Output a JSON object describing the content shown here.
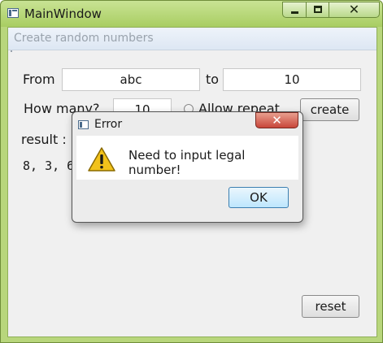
{
  "window": {
    "title": "MainWindow",
    "icon": "app-window-icon",
    "minimize_icon": "minimize-icon",
    "maximize_icon": "maximize-icon",
    "close_icon": "close-icon",
    "close_glyph": "✕"
  },
  "toolbar": {
    "label": "Create random numbers"
  },
  "form": {
    "from_label": "From",
    "from_value": "abc",
    "to_label": "to",
    "to_value": "10",
    "how_many_label": "How many?",
    "how_many_value": "10",
    "allow_repeat_label": "Allow repeat",
    "create_label": "create",
    "result_label": "result :",
    "result_value": "8, 3, 6,",
    "reset_label": "reset"
  },
  "dialog": {
    "title": "Error",
    "icon": "app-window-icon",
    "close_glyph": "✕",
    "warning_icon": "warning-icon",
    "message": "Need to input legal number!",
    "ok_label": "OK"
  },
  "colors": {
    "window_frame": "#b8d67c",
    "dialog_close": "#c8463a",
    "ok_button": "#bee6fd"
  }
}
